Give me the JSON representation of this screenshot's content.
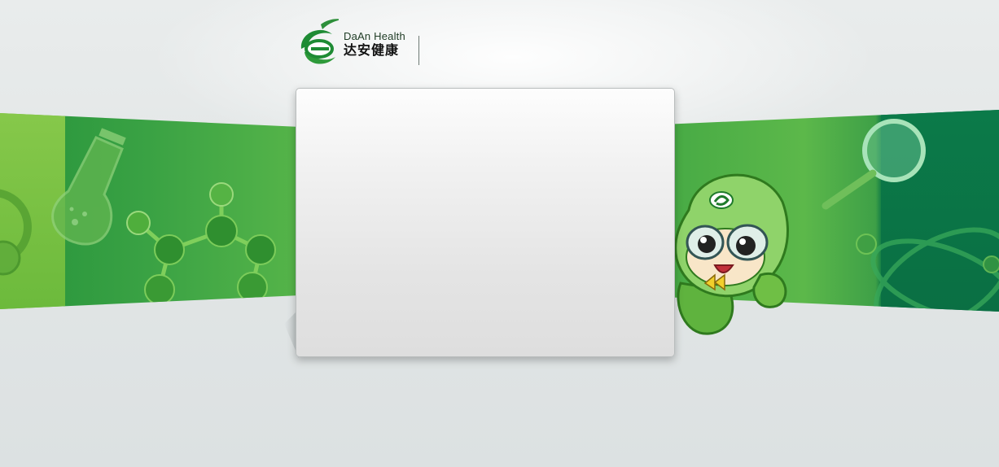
{
  "header": {
    "logo": {
      "brand_en": "DaAn Health",
      "brand_cn": "达安健康",
      "icon": "daan-e-logo-icon"
    }
  },
  "main_panel": {
    "content": ""
  },
  "decorations": {
    "left_banner_icons": [
      "flask-icon",
      "molecule-icon",
      "microscope-icon"
    ],
    "right_banner_icons": [
      "mascot-icon",
      "magnifier-icon",
      "atom-orbit-icon"
    ]
  },
  "colors": {
    "brand_green": "#2f9a3f",
    "light_green": "#7cc241",
    "dark_green": "#0c7447",
    "background": "#e2e6e6"
  }
}
